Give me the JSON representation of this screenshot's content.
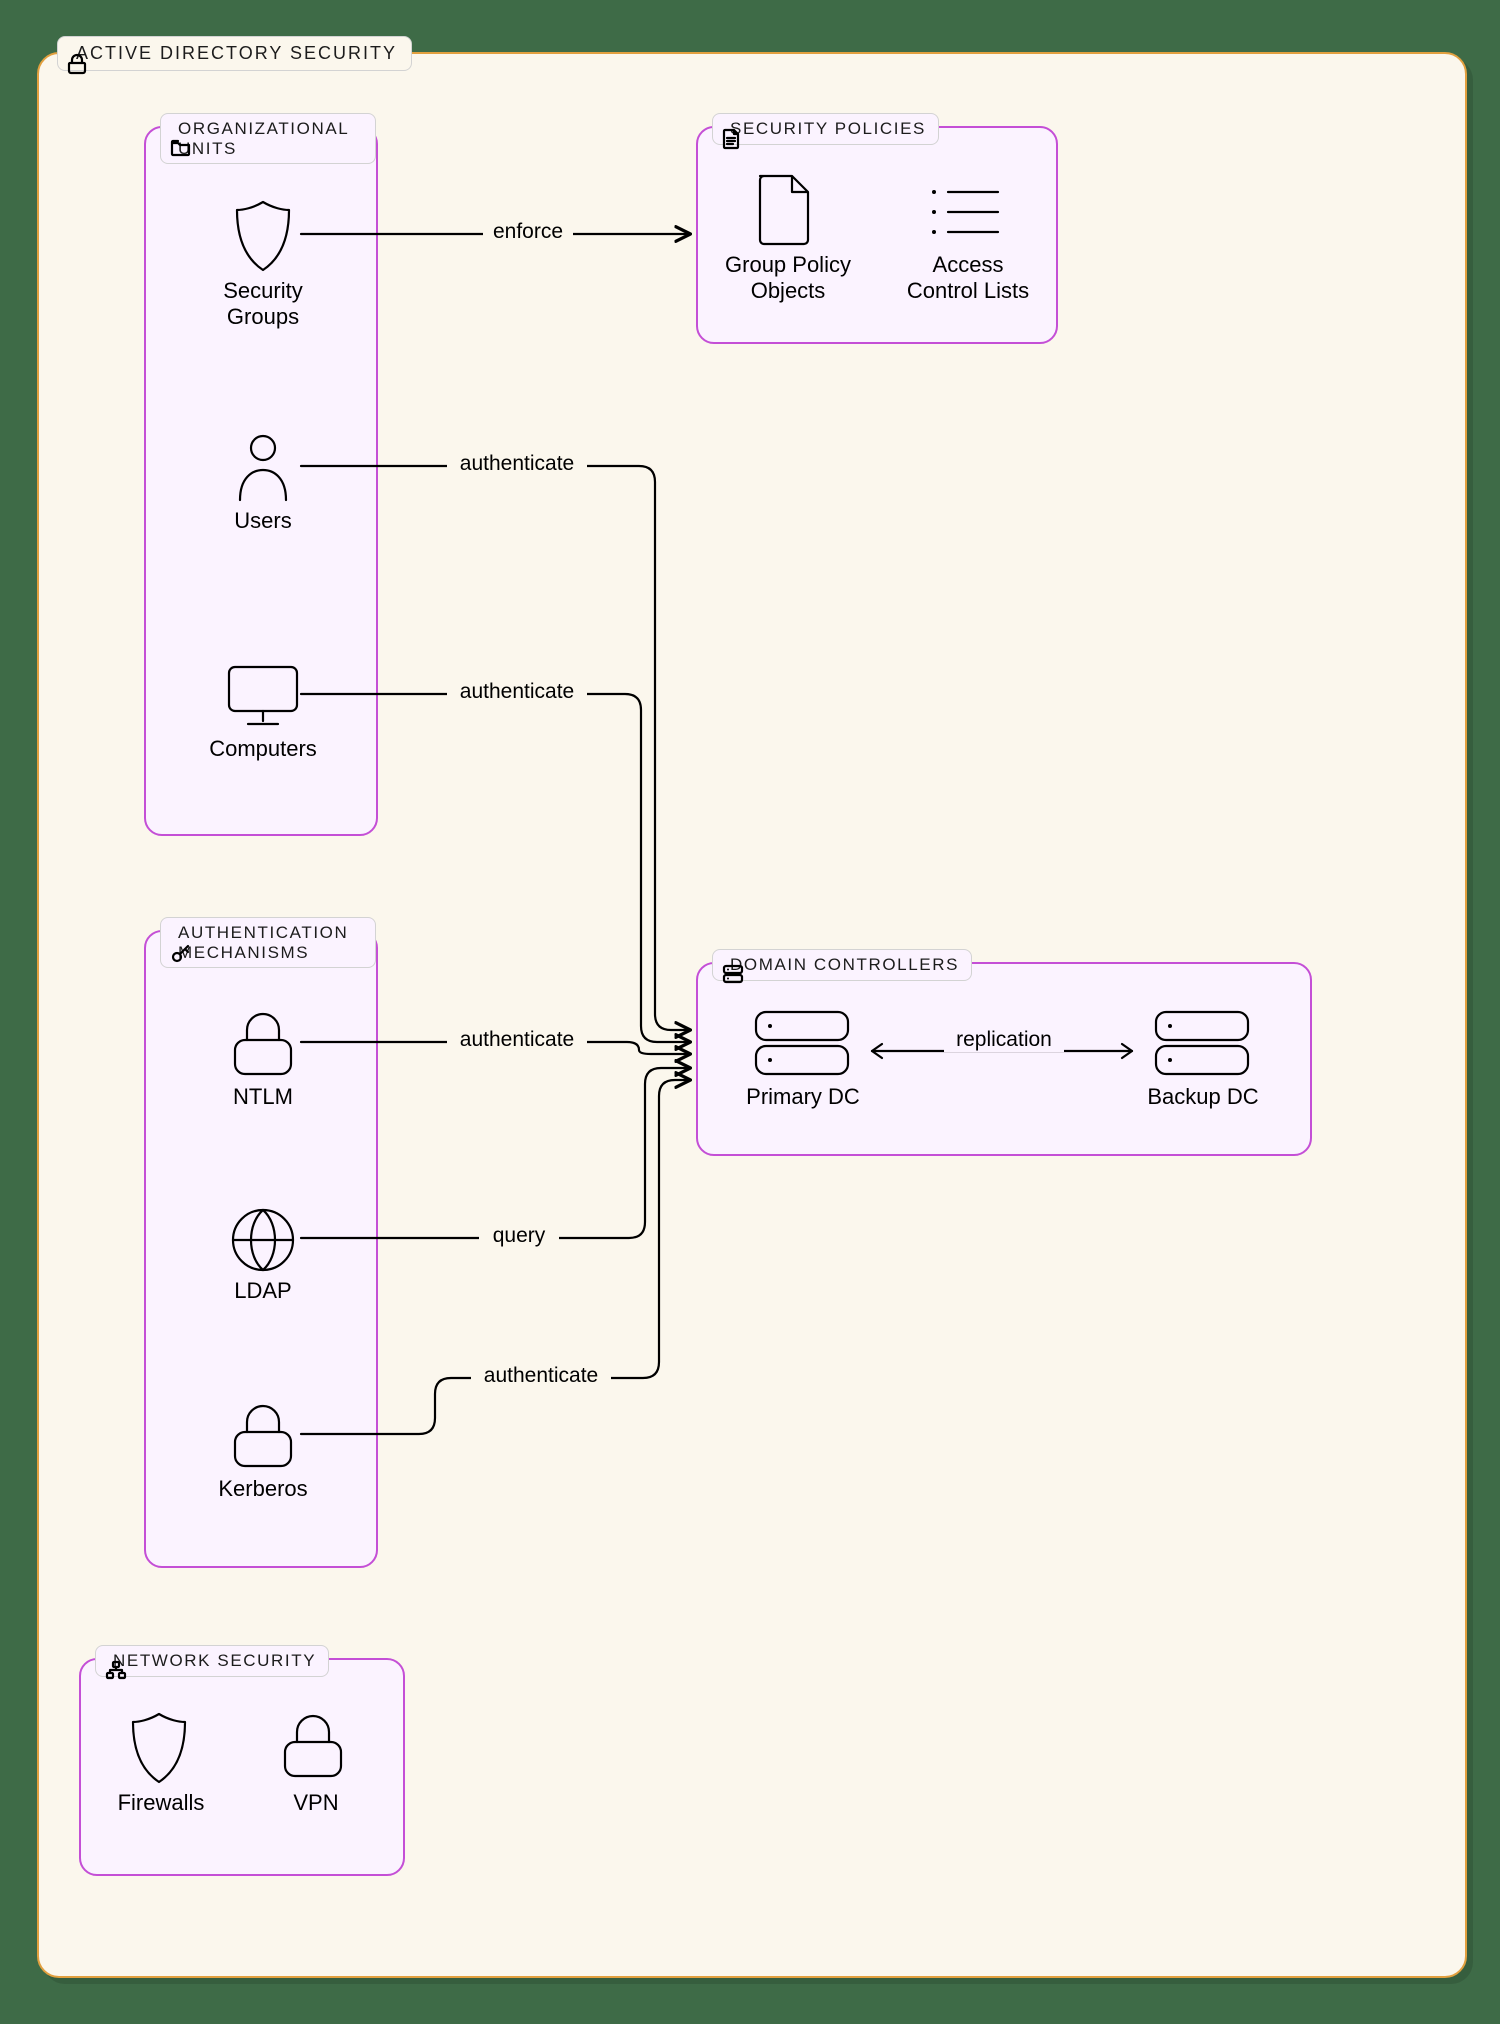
{
  "root": {
    "label": "ACTIVE DIRECTORY SECURITY"
  },
  "groups": {
    "ou": {
      "label": "ORGANIZATIONAL UNITS"
    },
    "sp": {
      "label": "SECURITY POLICIES"
    },
    "am": {
      "label": "AUTHENTICATION MECHANISMS"
    },
    "dc": {
      "label": "DOMAIN CONTROLLERS"
    },
    "ns": {
      "label": "NETWORK SECURITY"
    }
  },
  "nodes": {
    "sg": {
      "label": "Security Groups"
    },
    "users": {
      "label": "Users"
    },
    "comp": {
      "label": "Computers"
    },
    "gpo": {
      "label": "Group Policy Objects"
    },
    "acl": {
      "label": "Access Control Lists"
    },
    "ntlm": {
      "label": "NTLM"
    },
    "ldap": {
      "label": "LDAP"
    },
    "kerb": {
      "label": "Kerberos"
    },
    "pdc": {
      "label": "Primary DC"
    },
    "bdc": {
      "label": "Backup DC"
    },
    "fw": {
      "label": "Firewalls"
    },
    "vpn": {
      "label": "VPN"
    }
  },
  "edges": {
    "enforce": {
      "label": "enforce"
    },
    "auth1": {
      "label": "authenticate"
    },
    "auth2": {
      "label": "authenticate"
    },
    "auth3": {
      "label": "authenticate"
    },
    "query": {
      "label": "query"
    },
    "auth4": {
      "label": "authenticate"
    },
    "repl": {
      "label": "replication"
    }
  }
}
